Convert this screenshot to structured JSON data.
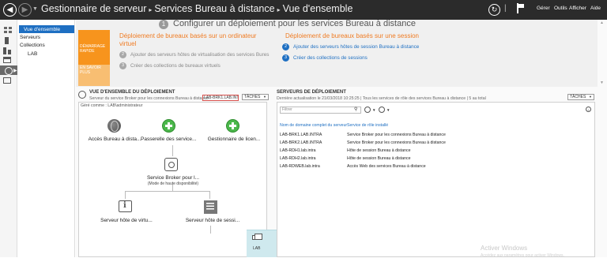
{
  "titlebar": {
    "breadcrumb": [
      "Gestionnaire de serveur",
      "Services Bureau à distance",
      "Vue d'ensemble"
    ],
    "separator": "▸",
    "refresh_icon": "refresh-icon",
    "menu": [
      "Gérer",
      "Outils",
      "Afficher",
      "Aide"
    ]
  },
  "subnav": {
    "items": [
      "Vue d'ensemble",
      "Serveurs",
      "Collections",
      "LAB"
    ]
  },
  "quickstart": {
    "step1": "Configurer un déploiement pour les services Bureau à distance",
    "band_top": "DÉMARRAGE RAPIDE",
    "band_bottom": "EN SAVOIR PLUS",
    "left_title": "Déploiement de bureaux basés sur un ordinateur virtuel",
    "left_steps": [
      {
        "num": "2",
        "label": "Ajouter des serveurs hôtes de virtualisation des services Bures"
      },
      {
        "num": "3",
        "label": "Créer des collections de bureaux virtuels"
      }
    ],
    "right_title": "Déploiement de bureaux basés sur une session",
    "right_steps": [
      {
        "num": "2",
        "label": "Ajouter des serveurs hôtes de session Bureau à distance"
      },
      {
        "num": "3",
        "label": "Créer des collections de sessions"
      }
    ]
  },
  "deployment": {
    "title": "VUE D'ENSEMBLE DU DÉPLOIEMENT",
    "subtitle": "Serveur du service Broker pour les connexions Bureau à distance :",
    "broker_value": "LAB-BRK1.LAB.INT...",
    "tasks": "TÂCHES",
    "managed_as": "Géré comme : LAB\\administrateur",
    "nodes": {
      "rdweb": "Accès Bureau à dista...",
      "gateway": "Passerelle des service...",
      "licensing": "Gestionnaire de licen...",
      "broker": "Service Broker pour l...",
      "broker_sub": "(Mode de haute disponibilité)",
      "virt_host": "Serveur hôte de virtu...",
      "session_host": "Serveur hôte de sessi..."
    },
    "collection_label": "LAB"
  },
  "servers": {
    "title": "SERVEURS DE DÉPLOIEMENT",
    "subtitle": "Dernière actualisation le 21/03/2018 10:25:25 | Tous les services de rôle des services Bureau à distance | 5 au total",
    "tasks": "TÂCHES",
    "filter_placeholder": "Filtrer",
    "columns": [
      "Nom de domaine complet du serveur",
      "Service de rôle installé"
    ],
    "rows": [
      [
        "LAB-BRK1.LAB.INTRA",
        "Service Broker pour les connexions Bureau à distance"
      ],
      [
        "LAB-BRK2.LAB.INTRA",
        "Service Broker pour les connexions Bureau à distance"
      ],
      [
        "LAB-RDH1.lab.intra",
        "Hôte de session Bureau à distance"
      ],
      [
        "LAB-RDH2.lab.intra",
        "Hôte de session Bureau à distance"
      ],
      [
        "LAB-RDWEB.lab.intra",
        "Accès Web des services Bureau à distance"
      ]
    ]
  },
  "watermark": {
    "line1": "Activer Windows",
    "line2": "Accédez aux paramètres pour activer Windows."
  }
}
